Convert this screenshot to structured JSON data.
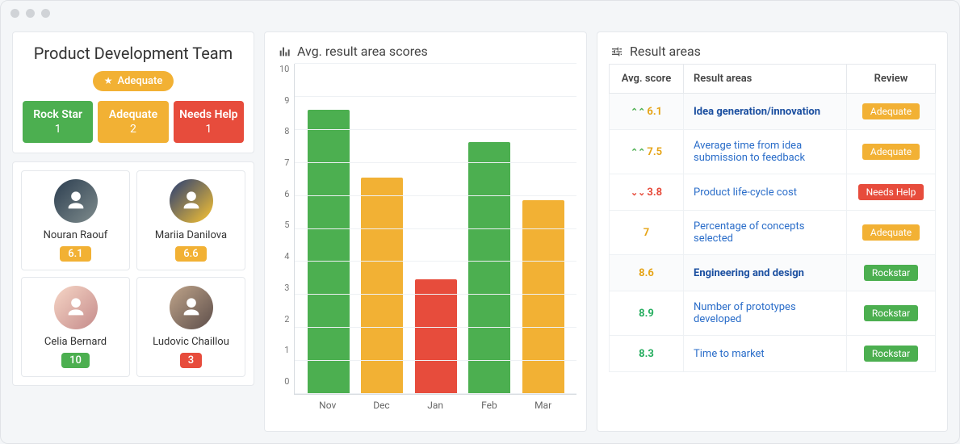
{
  "team": {
    "title": "Product Development Team",
    "overall_badge": {
      "label": "Adequate",
      "color": "#f2b134"
    },
    "stats": [
      {
        "label": "Rock Star",
        "count": 1,
        "color": "#4CAF50"
      },
      {
        "label": "Adequate",
        "count": 2,
        "color": "#f2b134"
      },
      {
        "label": "Needs Help",
        "count": 1,
        "color": "#e74c3c"
      }
    ],
    "members": [
      {
        "name": "Nouran Raouf",
        "score": "6.1",
        "score_color": "#f2b134"
      },
      {
        "name": "Mariia Danilova",
        "score": "6.6",
        "score_color": "#f2b134"
      },
      {
        "name": "Celia Bernard",
        "score": "10",
        "score_color": "#4CAF50"
      },
      {
        "name": "Ludovic Chaillou",
        "score": "3",
        "score_color": "#e74c3c"
      }
    ]
  },
  "chart_title": "Avg. result area scores",
  "chart_data": {
    "type": "bar",
    "categories": [
      "Nov",
      "Dec",
      "Jan",
      "Feb",
      "Mar"
    ],
    "values": [
      8.8,
      6.7,
      3.55,
      7.8,
      6.0
    ],
    "colors": [
      "#4CAF50",
      "#f2b134",
      "#e74c3c",
      "#4CAF50",
      "#f2b134"
    ],
    "title": "Avg. result area scores",
    "xlabel": "",
    "ylabel": "",
    "ylim": [
      0,
      10
    ],
    "yticks": [
      0,
      1,
      2,
      3,
      4,
      5,
      6,
      7,
      8,
      9,
      10
    ]
  },
  "result_areas": {
    "title": "Result areas",
    "columns": [
      "Avg. score",
      "Result areas",
      "Review"
    ],
    "rows": [
      {
        "group": true,
        "trend": "up",
        "score": "6.1",
        "score_class": "score-yellow",
        "area": "Idea generation/innovation",
        "badge": {
          "label": "Adequate",
          "color": "#f2b134"
        }
      },
      {
        "group": false,
        "trend": "up",
        "score": "7.5",
        "score_class": "score-yellow",
        "area": "Average time from idea submission to feedback",
        "badge": {
          "label": "Adequate",
          "color": "#f2b134"
        }
      },
      {
        "group": false,
        "trend": "down",
        "score": "3.8",
        "score_class": "score-red",
        "area": "Product life-cycle cost",
        "badge": {
          "label": "Needs Help",
          "color": "#e74c3c"
        }
      },
      {
        "group": false,
        "trend": "",
        "score": "7",
        "score_class": "score-yellow",
        "area": "Percentage of concepts selected",
        "badge": {
          "label": "Adequate",
          "color": "#f2b134"
        }
      },
      {
        "group": true,
        "trend": "",
        "score": "8.6",
        "score_class": "score-green",
        "area": "Engineering and design",
        "badge": {
          "label": "Rockstar",
          "color": "#4CAF50"
        }
      },
      {
        "group": false,
        "trend": "",
        "score": "8.9",
        "score_class": "score-green",
        "area": "Number of prototypes developed",
        "badge": {
          "label": "Rockstar",
          "color": "#4CAF50"
        }
      },
      {
        "group": false,
        "trend": "",
        "score": "8.3",
        "score_class": "score-green",
        "area": "Time to market",
        "badge": {
          "label": "Rockstar",
          "color": "#4CAF50"
        }
      }
    ]
  }
}
